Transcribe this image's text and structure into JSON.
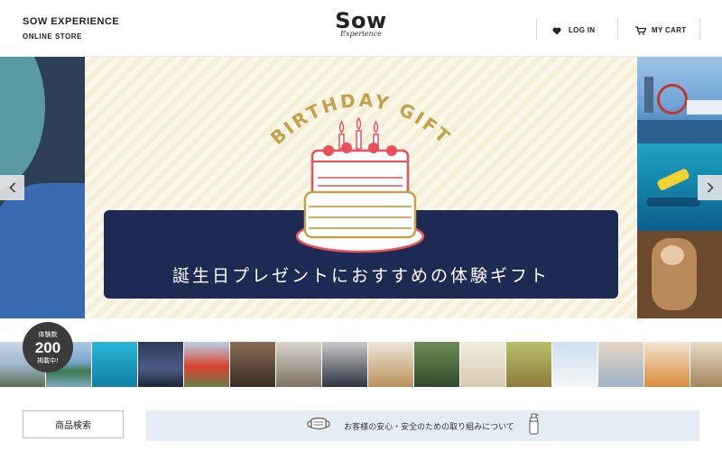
{
  "header": {
    "brand_title": "SOW EXPERIENCE",
    "brand_sub": "ONLINE STORE",
    "logo_main": "Sow",
    "logo_sub": "Experience",
    "login_label": "LOG IN",
    "cart_label": "MY CART"
  },
  "hero": {
    "arc_text": "BIRTHDAY GIFT",
    "banner_text": "誕生日プレゼントにおすすめの体験ギフト"
  },
  "badge": {
    "label_top": "体験数",
    "count": "200",
    "label_bottom": "掲載中!"
  },
  "strip": {
    "items": [
      "kayak",
      "island-boat",
      "snorkel",
      "hotel-night",
      "sightseeing-bus",
      "pottery",
      "cooking",
      "suits",
      "dining",
      "forest",
      "wine",
      "cheetah",
      "skiing",
      "sunset-sky",
      "fruit-dessert",
      "table"
    ]
  },
  "bottom": {
    "search_label": "商品検索",
    "notice_text": "お客様の安心・安全のための取り組みについて",
    "notice_icon_left": "mask-icon",
    "notice_icon_right": "spray-bottle-icon"
  },
  "colors": {
    "banner_navy": "#1c2a54",
    "gold": "#c2a24d",
    "cake_red": "#e8505a",
    "notice_bg": "#e4ecf5"
  }
}
